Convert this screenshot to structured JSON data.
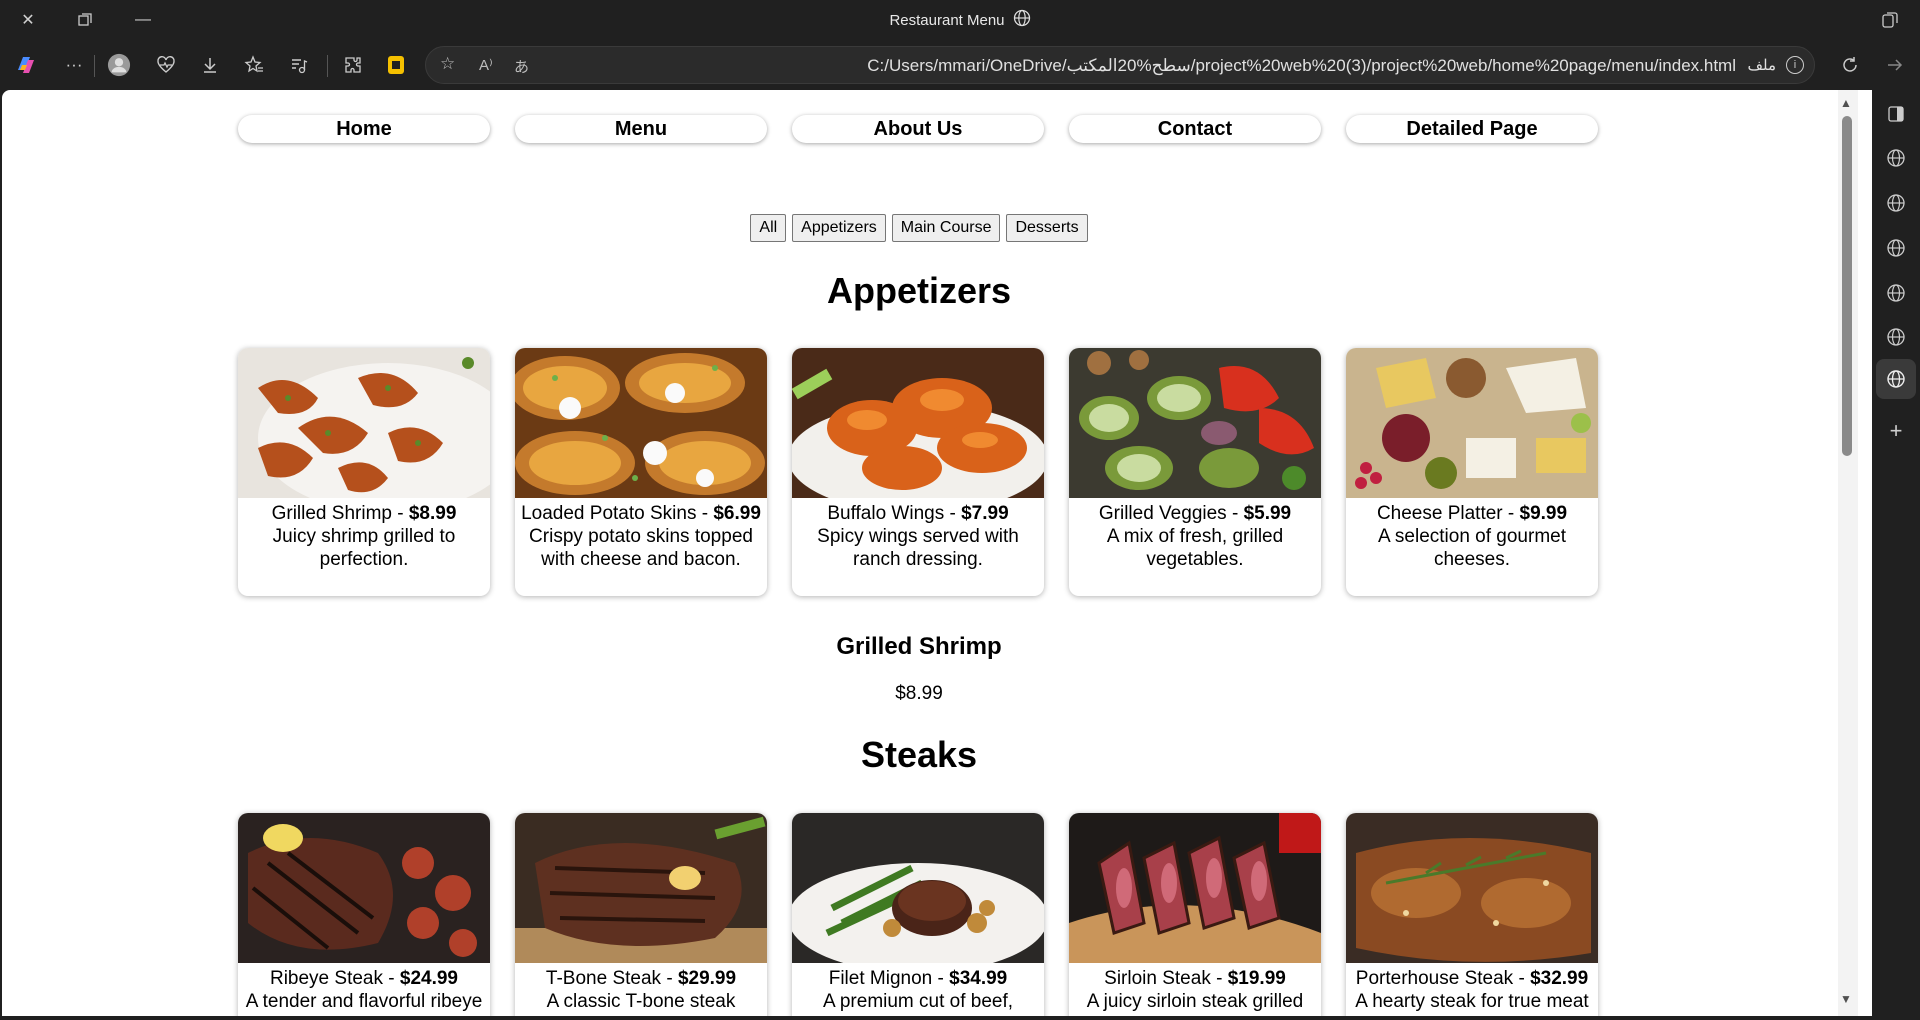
{
  "window": {
    "title": "Restaurant Menu"
  },
  "address": {
    "url": "C:/Users/mmari/OneDrive/سطح%20المكتب/project%20web%20(3)/project%20web/home%20page/menu/index.html",
    "file_label": "ملف"
  },
  "nav": {
    "items": [
      "Home",
      "Menu",
      "About Us",
      "Contact",
      "Detailed Page"
    ]
  },
  "filters": [
    "All",
    "Appetizers",
    "Main Course",
    "Desserts"
  ],
  "sections": [
    {
      "title": "Appetizers",
      "items": [
        {
          "name": "Grilled Shrimp",
          "price": "$8.99",
          "desc": "Juicy shrimp grilled to perfection."
        },
        {
          "name": "Loaded Potato Skins",
          "price": "$6.99",
          "desc": "Crispy potato skins topped with cheese and bacon."
        },
        {
          "name": "Buffalo Wings",
          "price": "$7.99",
          "desc": "Spicy wings served with ranch dressing."
        },
        {
          "name": "Grilled Veggies",
          "price": "$5.99",
          "desc": "A mix of fresh, grilled vegetables."
        },
        {
          "name": "Cheese Platter",
          "price": "$9.99",
          "desc": "A selection of gourmet cheeses."
        }
      ]
    },
    {
      "title": "Steaks",
      "items": [
        {
          "name": "Ribeye Steak",
          "price": "$24.99",
          "desc": "A tender and flavorful ribeye"
        },
        {
          "name": "T-Bone Steak",
          "price": "$29.99",
          "desc": "A classic T-bone steak"
        },
        {
          "name": "Filet Mignon",
          "price": "$34.99",
          "desc": "A premium cut of beef,"
        },
        {
          "name": "Sirloin Steak",
          "price": "$19.99",
          "desc": "A juicy sirloin steak grilled"
        },
        {
          "name": "Porterhouse Steak",
          "price": "$32.99",
          "desc": "A hearty steak for true meat"
        }
      ]
    }
  ],
  "detail": {
    "name": "Grilled Shrimp",
    "price": "$8.99"
  },
  "separator": " - ",
  "colors": {
    "chrome": "#202020",
    "page": "#ffffff"
  }
}
